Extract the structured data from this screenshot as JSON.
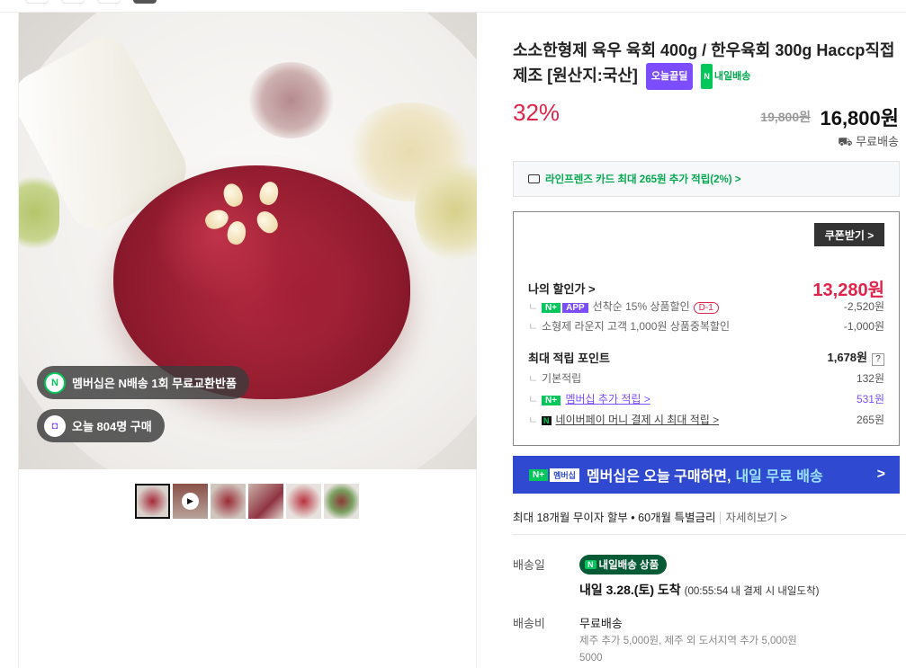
{
  "gallery": {
    "membership_pill": "멤버십은 N배송 1회 무료교환반품",
    "purchases_pill": "오늘 804명 구매",
    "thumbnail_count": 6
  },
  "product": {
    "title": "소소한형제 육우 육회 400g / 한우육회 300g Haccp직접제조 [원산지:국산]",
    "badge_today": "오늘끝딜",
    "badge_tomorrow": "내일배송",
    "discount_rate": "32%",
    "original_price": "19,800원",
    "sale_price": "16,800원",
    "shipping": "무료배송"
  },
  "card_promo": "라인프렌즈 카드 최대 265원 추가 적립(2%) >",
  "coupon": {
    "button": "쿠폰받기 >",
    "my_price_label": "나의 할인가 >",
    "my_price": "13,280원",
    "first_come_label": "선착순 15% 상품할인",
    "first_come_dday": "D-1",
    "first_come_amount": "-2,520원",
    "loyal_label": "소형제 라운지 고객 1,000원 상품중복할인",
    "loyal_amount": "-1,000원",
    "points_label": "최대 적립 포인트",
    "points_total": "1,678원",
    "basic_label": "기본적립",
    "basic_amount": "132원",
    "member_label": "멤버십 추가 적립 >",
    "member_amount": "531원",
    "npay_label": "네이버페이 머니 결제 시 최대 적립 >",
    "npay_amount": "265원",
    "nplus": "N+",
    "app": "APP",
    "question": "?"
  },
  "banner": {
    "nplus": "N+",
    "membership": "멤버십",
    "text": "멤버십은 오늘 구매하면,",
    "highlight": "내일 무료 배송",
    "chevron": ">"
  },
  "installment": {
    "text": "최대 18개월 무이자 할부 • 60개월 특별금리",
    "more": "자세히보기 >"
  },
  "delivery": {
    "date_label": "배송일",
    "badge": "내일배송 상품",
    "date": "내일 3.28.(토) 도착",
    "date_note": "(00:55:54 내 결제 시 내일도착)",
    "fee_label": "배송비",
    "fee": "무료배송",
    "fee_extra": "제주 추가 5,000원, 제주 외 도서지역 추가 5,000원",
    "fee_extra2": "5000"
  },
  "colors": {
    "accent_red": "#e0234a",
    "naver_green": "#03c75a",
    "purple": "#7b4dff",
    "banner_blue": "#2f49d1"
  }
}
